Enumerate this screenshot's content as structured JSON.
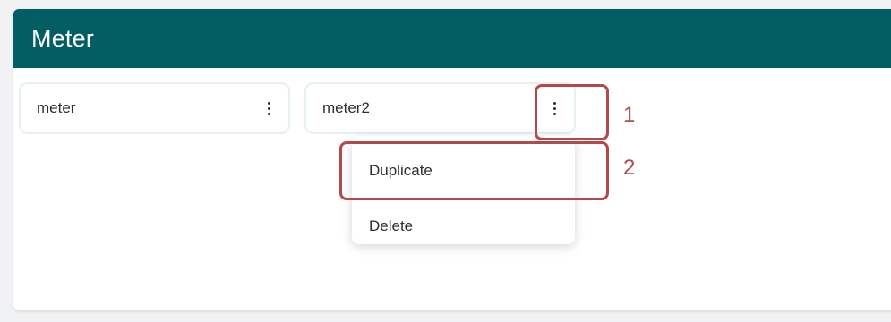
{
  "panel": {
    "title": "Meter"
  },
  "cards": [
    {
      "name": "meter"
    },
    {
      "name": "meter2"
    }
  ],
  "menu": {
    "items": [
      {
        "label": "Duplicate"
      },
      {
        "label": "Delete"
      }
    ]
  },
  "annotations": {
    "step1": "1",
    "step2": "2"
  },
  "colors": {
    "header": "#035e64",
    "annotation": "#b24a4c",
    "card_border": "#e6f0f1"
  }
}
